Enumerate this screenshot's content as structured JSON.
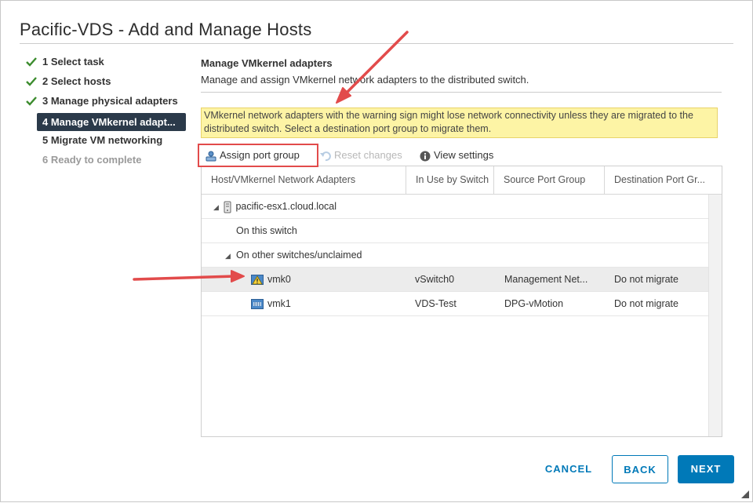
{
  "dialog": {
    "title": "Pacific-VDS - Add and Manage Hosts"
  },
  "steps": [
    {
      "label": "1 Select task",
      "state": "done"
    },
    {
      "label": "2 Select hosts",
      "state": "done"
    },
    {
      "label": "3 Manage physical adapters",
      "state": "done"
    },
    {
      "label": "4 Manage VMkernel adapt...",
      "state": "active"
    },
    {
      "label": "5 Migrate VM networking",
      "state": "pending"
    },
    {
      "label": "6 Ready to complete",
      "state": "disabled"
    }
  ],
  "main": {
    "title": "Manage VMkernel adapters",
    "description": "Manage and assign VMkernel network adapters to the distributed switch.",
    "warning": "VMkernel network adapters with the warning sign might lose network connectivity unless they are migrated to the distributed switch. Select a destination port group to migrate them."
  },
  "toolbar": {
    "assign_label": "Assign port group",
    "reset_label": "Reset changes",
    "view_label": "View settings"
  },
  "grid": {
    "columns": [
      "Host/VMkernel Network Adapters",
      "In Use by Switch",
      "Source Port Group",
      "Destination Port Gr..."
    ],
    "host": "pacific-esx1.cloud.local",
    "group_this": "On this switch",
    "group_other": "On other switches/unclaimed",
    "rows": [
      {
        "name": "vmk0",
        "switch": "vSwitch0",
        "source": "Management Net...",
        "dest": "Do not migrate",
        "warning": true
      },
      {
        "name": "vmk1",
        "switch": "VDS-Test",
        "source": "DPG-vMotion",
        "dest": "Do not migrate",
        "warning": false
      }
    ]
  },
  "footer": {
    "cancel_label": "CANCEL",
    "back_label": "BACK",
    "next_label": "NEXT"
  },
  "colors": {
    "accent": "#0079b8",
    "active_step_bg": "#2b3a4a",
    "warning_bg": "#fdf4a5",
    "check": "#3c8c2e",
    "annotation": "#e24b4b"
  },
  "icons": [
    "check-icon",
    "assign-port-group-icon",
    "undo-icon",
    "info-icon",
    "host-icon",
    "vmkernel-adapter-icon",
    "warning-icon"
  ]
}
